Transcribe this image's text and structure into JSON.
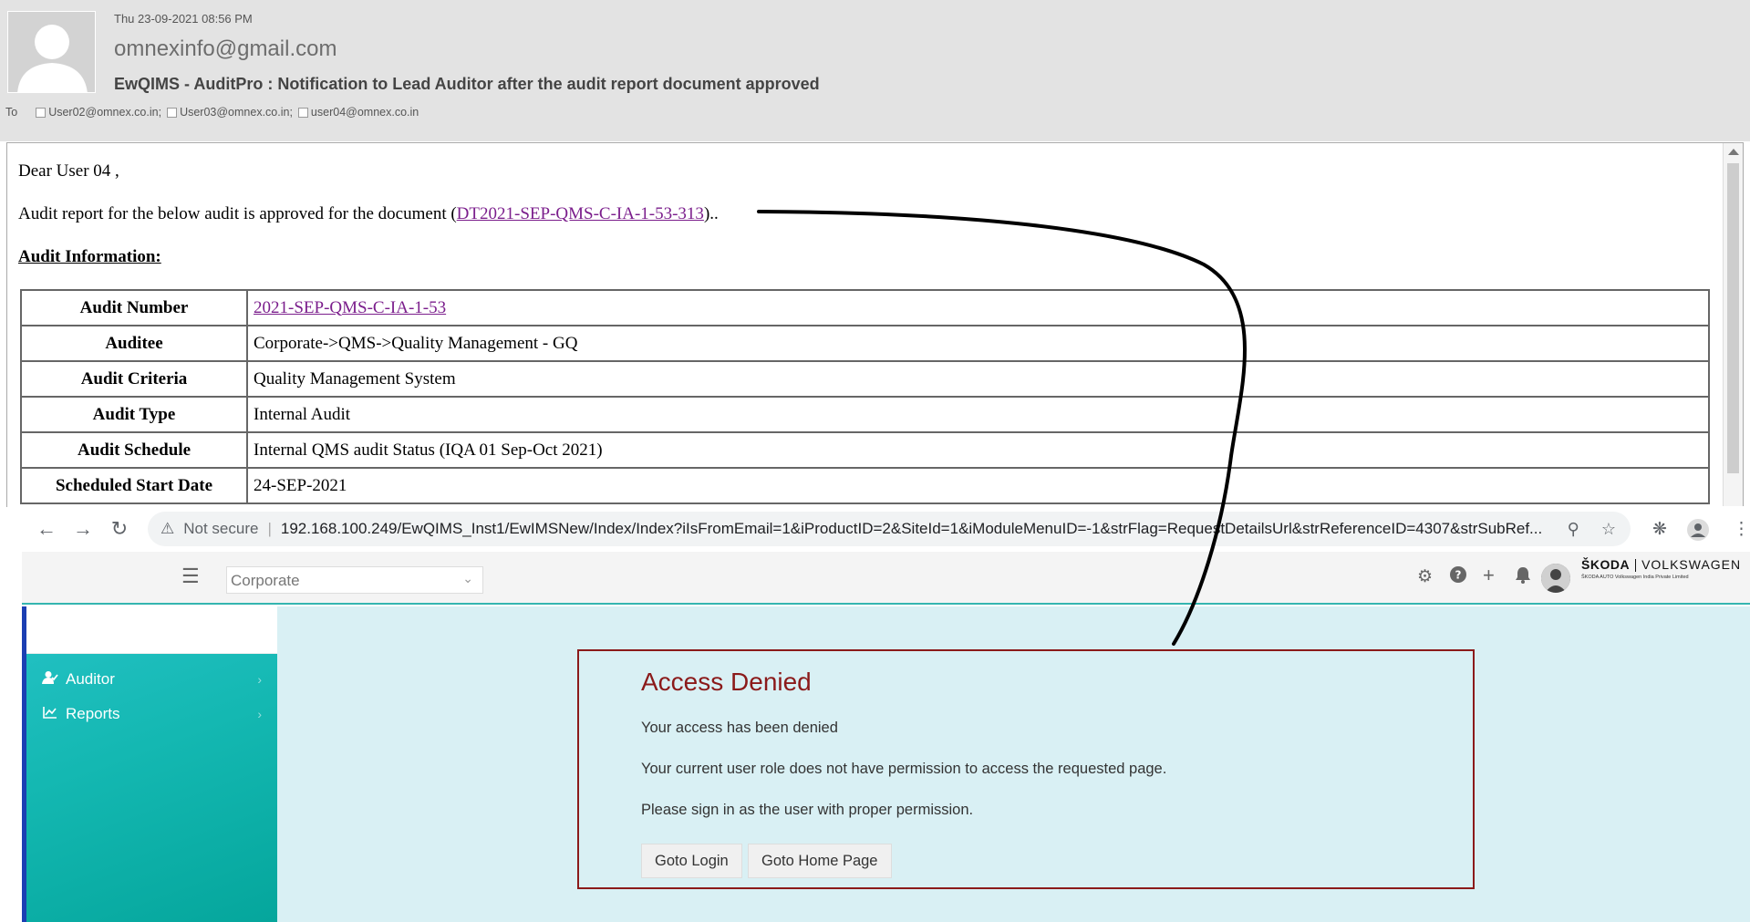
{
  "email": {
    "date": "Thu 23-09-2021 08:56 PM",
    "from": "omnexinfo@gmail.com",
    "subject": "EwQIMS - AuditPro : Notification to Lead Auditor after the audit report document approved",
    "to_label": "To",
    "recipients": [
      "User02@omnex.co.in;",
      "User03@omnex.co.in;",
      "user04@omnex.co.in"
    ],
    "greeting": "Dear User 04 ,",
    "line1_prefix": "Audit report for the below audit is approved for the document (",
    "document_link": "DT2021-SEP-QMS-C-IA-1-53-313",
    "line1_suffix": ")..",
    "section_heading": "Audit Information:",
    "audit_info": [
      {
        "label": "Audit Number",
        "value": "2021-SEP-QMS-C-IA-1-53"
      },
      {
        "label": "Auditee",
        "value": "Corporate->QMS->Quality Management - GQ"
      },
      {
        "label": "Audit Criteria",
        "value": "Quality Management System"
      },
      {
        "label": "Audit Type",
        "value": "Internal Audit"
      },
      {
        "label": "Audit Schedule",
        "value": "Internal QMS audit Status (IQA 01 Sep-Oct 2021)"
      },
      {
        "label": "Scheduled Start Date",
        "value": "24-SEP-2021"
      }
    ]
  },
  "browser": {
    "security_label": "Not secure",
    "url": "192.168.100.249/EwQIMS_Inst1/EwIMSNew/Index/Index?iIsFromEmail=1&iProductID=2&SiteId=1&iModuleMenuID=-1&strFlag=RequestDetailsUrl&strReferenceID=4307&strSubRef..."
  },
  "app": {
    "site_select_value": "Corporate",
    "brand_primary": "ŠKODA",
    "brand_secondary": "VOLKSWAGEN",
    "brand_tagline": "ŠKODA AUTO Volkswagen India Private Limited",
    "sidebar_items": [
      {
        "label": "Auditor",
        "icon": "user-check-icon"
      },
      {
        "label": "Reports",
        "icon": "line-chart-icon"
      }
    ],
    "access_denied": {
      "title": "Access Denied",
      "msg1": "Your access has been denied",
      "msg2": "Your current user role does not have permission to access the requested page.",
      "msg3": "Please sign in as the user with proper permission.",
      "login_button": "Goto Login",
      "home_button": "Goto Home Page"
    }
  },
  "colors": {
    "link": "#7b1e8c",
    "denied": "#8b1a1a",
    "sidebar": "#14b8b2",
    "content_bg": "#d9f0f4"
  }
}
